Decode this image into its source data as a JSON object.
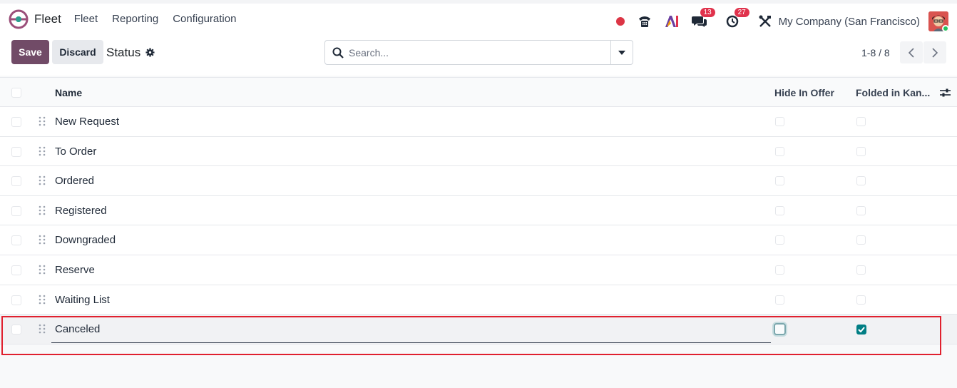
{
  "app": {
    "name": "Fleet"
  },
  "menu": [
    {
      "label": "Fleet"
    },
    {
      "label": "Reporting"
    },
    {
      "label": "Configuration"
    }
  ],
  "systray": {
    "messages_badge": "13",
    "activities_badge": "27",
    "company": "My Company (San Francisco)"
  },
  "control": {
    "save_label": "Save",
    "discard_label": "Discard",
    "title": "Status",
    "search_placeholder": "Search...",
    "pager": "1-8 / 8"
  },
  "table": {
    "headers": {
      "name": "Name",
      "hide_in_offer": "Hide In Offer",
      "folded": "Folded in Kan..."
    },
    "rows": [
      {
        "name": "New Request",
        "hide_in_offer": false,
        "folded": false
      },
      {
        "name": "To Order",
        "hide_in_offer": false,
        "folded": false
      },
      {
        "name": "Ordered",
        "hide_in_offer": false,
        "folded": false
      },
      {
        "name": "Registered",
        "hide_in_offer": false,
        "folded": false
      },
      {
        "name": "Downgraded",
        "hide_in_offer": false,
        "folded": false
      },
      {
        "name": "Reserve",
        "hide_in_offer": false,
        "folded": false
      },
      {
        "name": "Waiting List",
        "hide_in_offer": false,
        "folded": false
      },
      {
        "name": "Canceled",
        "hide_in_offer": false,
        "folded": true
      }
    ]
  },
  "colors": {
    "primary": "#714b67",
    "checkbox_checked": "#017e84",
    "highlight": "#e0202e"
  }
}
